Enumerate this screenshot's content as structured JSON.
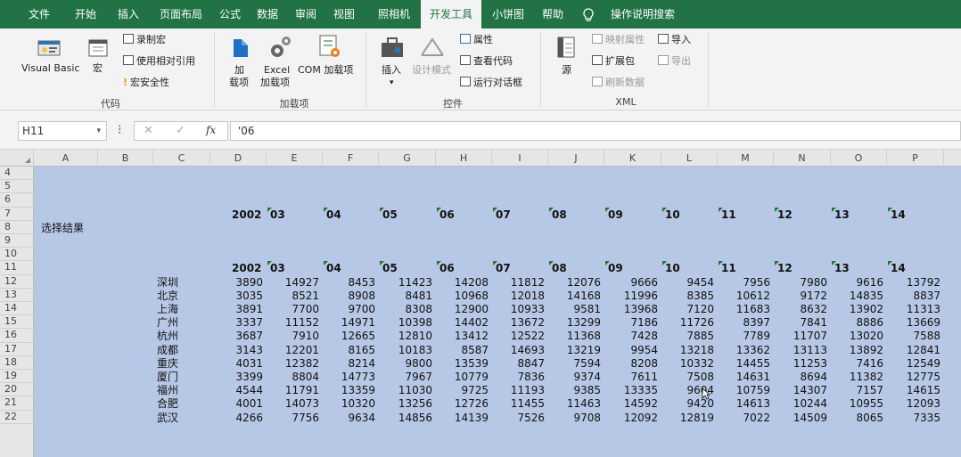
{
  "ribbon_tabs": [
    "文件",
    "开始",
    "插入",
    "页面布局",
    "公式",
    "数据",
    "审阅",
    "视图",
    "照相机",
    "开发工具",
    "小饼图",
    "帮助"
  ],
  "tell_me": "操作说明搜索",
  "ribbon": {
    "code": {
      "visual_basic": "Visual Basic",
      "macros": "宏",
      "record": "录制宏",
      "relative": "使用相对引用",
      "security": "宏安全性",
      "label": "代码"
    },
    "addins": {
      "addins_l1": "加",
      "addins_l2": "载项",
      "excel_l1": "Excel",
      "excel_l2": "加载项",
      "com": "COM 加载项",
      "label": "加载项"
    },
    "controls": {
      "insert": "插入",
      "design": "设计模式",
      "properties": "属性",
      "view_code": "查看代码",
      "run_dialog": "运行对话框",
      "label": "控件"
    },
    "xml": {
      "source": "源",
      "map_props": "映射属性",
      "expansion": "扩展包",
      "refresh": "刷新数据",
      "import": "导入",
      "export": "导出",
      "label": "XML"
    }
  },
  "formula": {
    "namebox": "H11",
    "fx": "fx",
    "value": "'06"
  },
  "columns": [
    "A",
    "B",
    "C",
    "D",
    "E",
    "F",
    "G",
    "H",
    "I",
    "J",
    "K",
    "L",
    "M",
    "N",
    "O",
    "P"
  ],
  "rows": [
    "4",
    "5",
    "6",
    "7",
    "8",
    "9",
    "10",
    "11",
    "12",
    "13",
    "14",
    "15",
    "16",
    "17",
    "18",
    "19",
    "20",
    "21",
    "22"
  ],
  "sheet": {
    "label_a8": "选择结果",
    "header_d7": "2002",
    "header_d11": "2002",
    "year_headers": [
      "03",
      "04",
      "05",
      "06",
      "07",
      "08",
      "09",
      "10",
      "11",
      "12",
      "13",
      "14"
    ],
    "cities": [
      "深圳",
      "北京",
      "上海",
      "广州",
      "杭州",
      "成都",
      "重庆",
      "厦门",
      "福州",
      "合肥",
      "武汉"
    ],
    "values": [
      [
        "3890",
        "14927",
        "8453",
        "11423",
        "14208",
        "11812",
        "12076",
        "9666",
        "9454",
        "7956",
        "7980",
        "9616",
        "13792"
      ],
      [
        "3035",
        "8521",
        "8908",
        "8481",
        "10968",
        "12018",
        "14168",
        "11996",
        "8385",
        "10612",
        "9172",
        "14835",
        "8837"
      ],
      [
        "3891",
        "7700",
        "9700",
        "8308",
        "12900",
        "10933",
        "9581",
        "13968",
        "7120",
        "11683",
        "8632",
        "13902",
        "11313"
      ],
      [
        "3337",
        "11152",
        "14971",
        "10398",
        "14402",
        "13672",
        "13299",
        "7186",
        "11726",
        "8397",
        "7841",
        "8886",
        "13669"
      ],
      [
        "3687",
        "7910",
        "12665",
        "12810",
        "13412",
        "12522",
        "11368",
        "7428",
        "7885",
        "7789",
        "11707",
        "13020",
        "7588"
      ],
      [
        "3143",
        "12201",
        "8165",
        "10183",
        "8587",
        "14693",
        "13219",
        "9954",
        "13218",
        "13362",
        "13113",
        "13892",
        "12841"
      ],
      [
        "4031",
        "12382",
        "8214",
        "9800",
        "13539",
        "8847",
        "7594",
        "8208",
        "10332",
        "14455",
        "11253",
        "7416",
        "12549"
      ],
      [
        "3399",
        "8804",
        "14773",
        "7967",
        "10779",
        "7836",
        "9374",
        "7611",
        "7508",
        "14631",
        "8694",
        "11382",
        "12775"
      ],
      [
        "4544",
        "11791",
        "13359",
        "11030",
        "9725",
        "11193",
        "9385",
        "13335",
        "9604",
        "10759",
        "14307",
        "7157",
        "14615"
      ],
      [
        "4001",
        "14073",
        "10320",
        "13256",
        "12726",
        "11455",
        "11463",
        "14592",
        "9420",
        "14613",
        "10244",
        "10955",
        "12093"
      ],
      [
        "4266",
        "7756",
        "9634",
        "14856",
        "14139",
        "7526",
        "9708",
        "12092",
        "12819",
        "7022",
        "14509",
        "8065",
        "7335"
      ]
    ]
  }
}
